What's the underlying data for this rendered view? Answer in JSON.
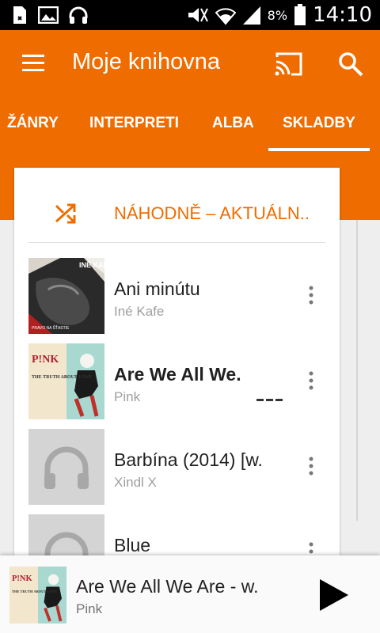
{
  "status_bar": {
    "time": "14:10",
    "battery_percent": "8%",
    "left_icons": [
      "sd-card-icon",
      "image-icon",
      "headphones-icon"
    ],
    "right_icons": [
      "mute-icon",
      "wifi-icon",
      "signal-icon",
      "battery-icon"
    ]
  },
  "app_bar": {
    "title": "Moje knihovna",
    "color": "#ef6c00"
  },
  "tabs": [
    {
      "label": "ŽÁNRY",
      "selected": false
    },
    {
      "label": "INTERPRETI",
      "selected": false
    },
    {
      "label": "ALBA",
      "selected": false
    },
    {
      "label": "SKLADBY",
      "selected": true
    }
  ],
  "shuffle": {
    "label": "NÁHODNĚ – AKTUÁLN.."
  },
  "songs": [
    {
      "title": "Ani minútu",
      "artist": "Iné Kafe",
      "art_text": "INÉ KAFE",
      "art_subtext": "PRAVO NA ŠŤASTIE",
      "bold": false,
      "playing": false
    },
    {
      "title": "Are We All We.",
      "artist": "Pink",
      "art_text": "P!NK",
      "art_subtext": "THE TRUTH ABOUT LOVE",
      "bold": true,
      "playing": true
    },
    {
      "title": "Barbína (2014) [w.",
      "artist": "Xindl X",
      "art_text": "",
      "bold": false,
      "playing": false
    },
    {
      "title": "Blue",
      "artist": "",
      "art_text": "",
      "bold": false,
      "playing": false
    }
  ],
  "now_playing": {
    "title": "Are We All We Are - w.",
    "artist": "Pink",
    "art_text": "P!NK",
    "art_subtext": "THE TRUTH ABOUT LOVE"
  }
}
